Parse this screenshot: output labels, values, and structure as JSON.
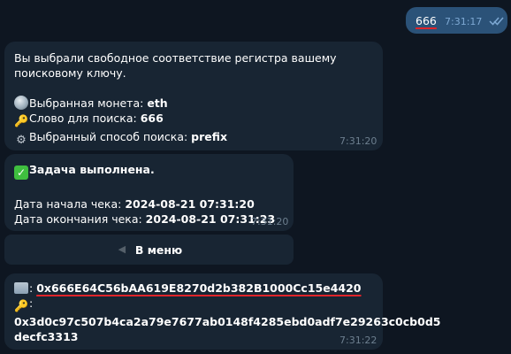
{
  "outgoing": {
    "text": "666",
    "time": "7:31:17"
  },
  "msg1": {
    "line1": "Вы выбрали свободное соответствие регистра вашему",
    "line2": "поисковому ключу.",
    "coin_label": "Выбранная монета: ",
    "coin_value": "eth",
    "word_label": "Слово для поиска: ",
    "word_value": "666",
    "method_label": "Выбранный способ поиска: ",
    "method_value": "prefix",
    "time": "7:31:20"
  },
  "msg2": {
    "title": "Задача выполнена.",
    "start_label": "Дата начала чека: ",
    "start_value": "2024-08-21 07:31:20",
    "end_label": "Дата окончания чека: ",
    "end_value": "2024-08-21 07:31:23",
    "time": "7:31:20"
  },
  "menu_button": {
    "label": "В меню"
  },
  "msg3": {
    "address_prefix": ": ",
    "address": "0x666E64C56bAA619E8270d2b382B1000Cc15e4420",
    "key_prefix": ":",
    "key_line1": "0x3d0c97c507b4ca2a79e7677ab0148f4285ebd0adf7e29263c0cb0d5",
    "key_line2": "decfc3313",
    "time": "7:31:22"
  },
  "icons": {
    "globe": "globe-icon",
    "key": "key-icon",
    "gear": "gear-icon",
    "check": "check-mark-icon",
    "folder": "folder-icon",
    "back": "back-arrow-icon",
    "read_receipt": "double-check-icon"
  },
  "colors": {
    "background": "#0e1621",
    "incoming_bubble": "#182533",
    "outgoing_bubble": "#2b5278",
    "underline": "#e0242a"
  }
}
